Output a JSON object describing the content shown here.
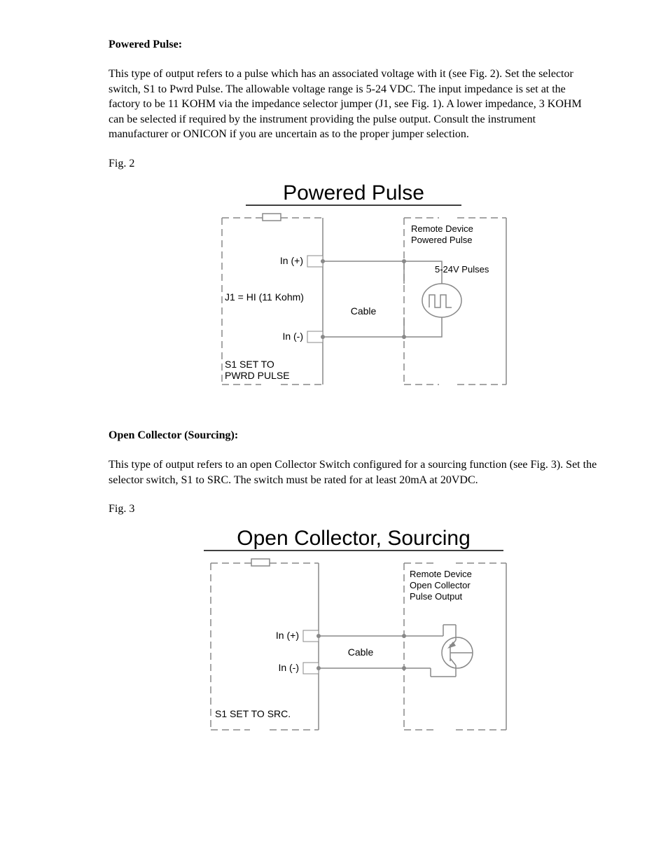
{
  "section1": {
    "heading": "Powered Pulse:",
    "body": "This type of output refers to a pulse which has an associated voltage with it (see Fig. 2). Set the selector switch, S1 to Pwrd Pulse. The allowable voltage range is 5-24 VDC. The input impedance is set at the factory to be 11 KOHM via the impedance selector jumper (J1, see Fig. 1). A lower impedance, 3 KOHM can be selected if required by the instrument providing the pulse output. Consult the instrument manufacturer or ONICON if you are uncertain as to the proper jumper selection.",
    "fig_label": "Fig. 2"
  },
  "figure2": {
    "title": "Powered Pulse",
    "in_plus": "In (+)",
    "in_minus": "In (-)",
    "j1": "J1 = HI (11 Kohm)",
    "s1_line1": "S1 SET TO",
    "s1_line2": "PWRD PULSE",
    "cable": "Cable",
    "remote_line1": "Remote Device",
    "remote_line2": "Powered Pulse",
    "pulses": "5-24V Pulses"
  },
  "section2": {
    "heading": "Open Collector (Sourcing):",
    "body": "This type of output refers to an open Collector Switch configured for a sourcing function (see Fig. 3). Set the selector switch, S1 to SRC. The switch must be rated for at least 20mA at 20VDC.",
    "fig_label": "Fig. 3"
  },
  "figure3": {
    "title": "Open Collector, Sourcing",
    "in_plus": "In (+)",
    "in_minus": "In (-)",
    "s1": "S1 SET TO SRC.",
    "cable": "Cable",
    "remote_line1": "Remote Device",
    "remote_line2": "Open Collector",
    "remote_line3": "Pulse Output"
  }
}
